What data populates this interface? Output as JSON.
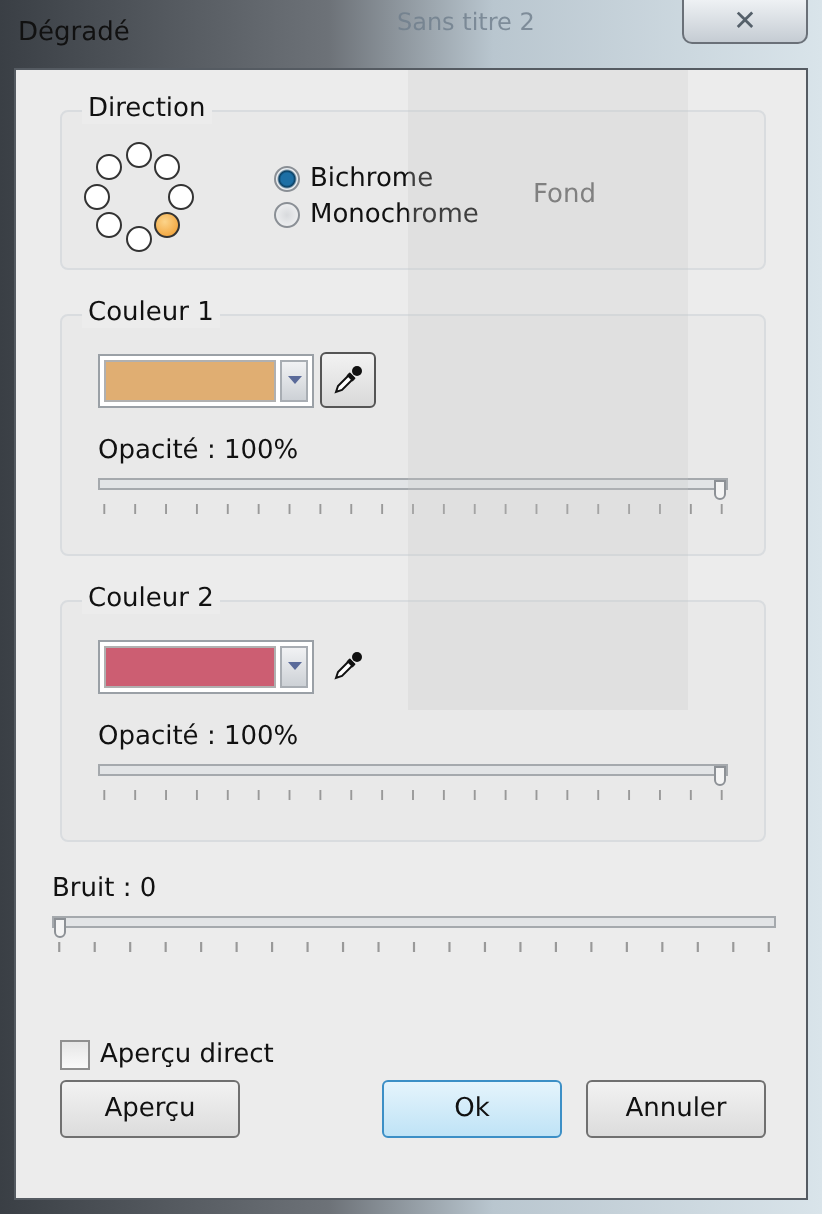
{
  "window": {
    "title": "Dégradé",
    "close": "✕"
  },
  "background_window": {
    "title": "Sans titre 2",
    "layer": "Fond"
  },
  "direction": {
    "title": "Direction",
    "positions": [
      {
        "selected": false
      },
      {
        "selected": false
      },
      {
        "selected": false
      },
      {
        "selected": true
      },
      {
        "selected": false
      },
      {
        "selected": false
      },
      {
        "selected": false
      },
      {
        "selected": false
      }
    ],
    "modes": [
      {
        "label": "Bichrome",
        "selected": true
      },
      {
        "label": "Monochrome",
        "selected": false
      }
    ]
  },
  "colors": [
    {
      "title": "Couleur 1",
      "color": "#e0ae72",
      "picker_pressed": true,
      "opacity_label": "Opacité : 100%",
      "level": 1
    },
    {
      "title": "Couleur 2",
      "color": "#cc5e72",
      "picker_pressed": false,
      "opacity_label": "Opacité : 100%",
      "level": 1
    }
  ],
  "noise": {
    "label": "Bruit : 0",
    "level": 0
  },
  "live_preview": {
    "label": "Aperçu direct",
    "checked": false
  },
  "buttons": [
    {
      "label": "Aperçu",
      "default": false
    },
    {
      "label": "Ok",
      "default": true
    },
    {
      "label": "Annuler",
      "default": false
    }
  ]
}
